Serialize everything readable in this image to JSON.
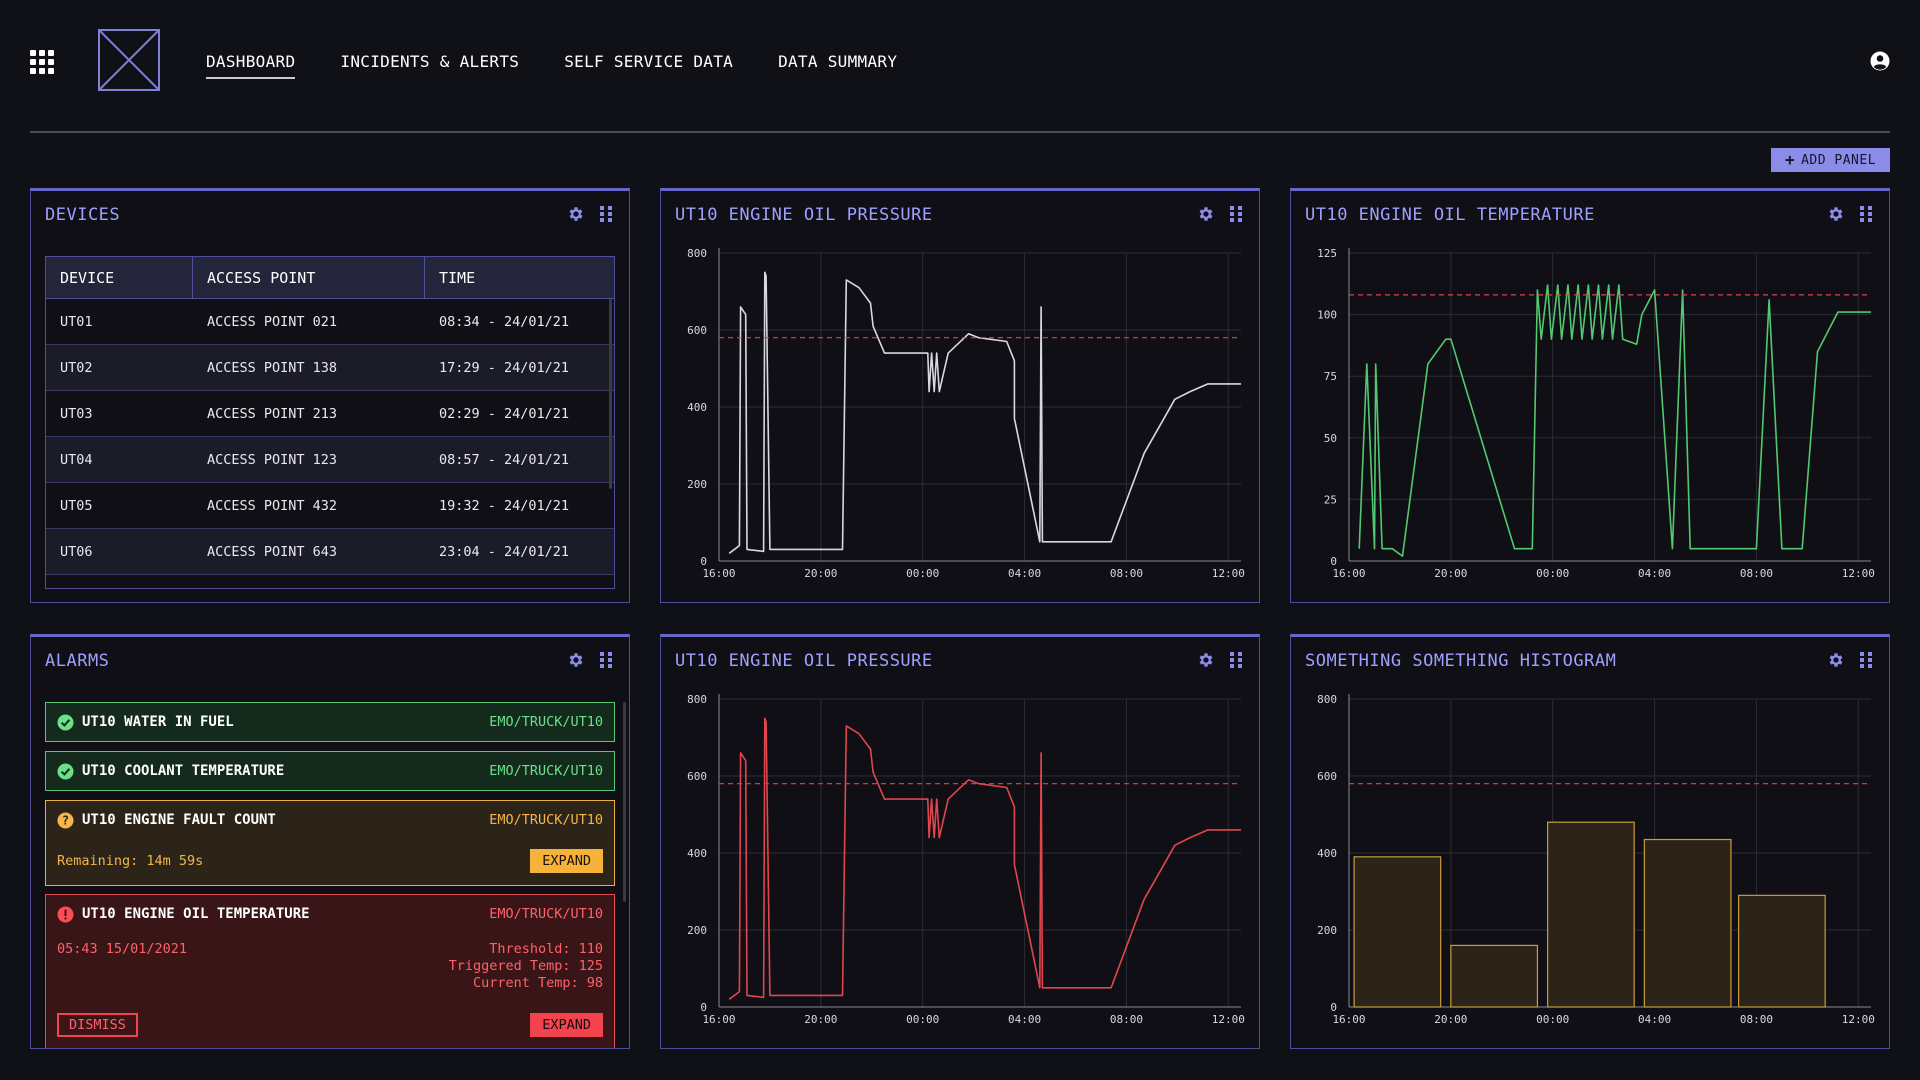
{
  "nav": {
    "items": [
      "DASHBOARD",
      "INCIDENTS & ALERTS",
      "SELF SERVICE DATA",
      "DATA SUMMARY"
    ],
    "active": "DASHBOARD"
  },
  "toolbar": {
    "add_panel_label": "ADD PANEL"
  },
  "colors": {
    "accent": "#8b8ce8",
    "panel_title": "#9fa0ff",
    "line_white": "#d8d8e0",
    "line_green": "#52c970",
    "line_red": "#e0464e",
    "bar_fill": "#2c2419",
    "bar_stroke": "#c99b3e",
    "threshold": "#d9454e"
  },
  "devices": {
    "title": "DEVICES",
    "columns": [
      "DEVICE",
      "ACCESS POINT",
      "TIME"
    ],
    "rows": [
      [
        "UT01",
        "ACCESS POINT 021",
        "08:34 - 24/01/21"
      ],
      [
        "UT02",
        "ACCESS POINT 138",
        "17:29 - 24/01/21"
      ],
      [
        "UT03",
        "ACCESS POINT 213",
        "02:29 - 24/01/21"
      ],
      [
        "UT04",
        "ACCESS POINT 123",
        "08:57 - 24/01/21"
      ],
      [
        "UT05",
        "ACCESS POINT 432",
        "19:32 - 24/01/21"
      ],
      [
        "UT06",
        "ACCESS POINT 643",
        "23:04 - 24/01/21"
      ]
    ]
  },
  "alarms": {
    "title": "ALARMS",
    "items": [
      {
        "status": "ok",
        "title": "UT10 WATER IN FUEL",
        "path": "EMO/TRUCK/UT10"
      },
      {
        "status": "ok",
        "title": "UT10 COOLANT TEMPERATURE",
        "path": "EMO/TRUCK/UT10"
      },
      {
        "status": "warning",
        "title": "UT10 ENGINE FAULT COUNT",
        "path": "EMO/TRUCK/UT10",
        "remaining": "Remaining: 14m 59s",
        "expand_label": "EXPAND"
      },
      {
        "status": "error",
        "title": "UT10 ENGINE OIL TEMPERATURE",
        "path": "EMO/TRUCK/UT10",
        "timestamp": "05:43 15/01/2021",
        "threshold": "Threshold: 110",
        "triggered": "Triggered Temp: 125",
        "current": "Current Temp: 98",
        "dismiss_label": "DISMISS",
        "expand_label": "EXPAND"
      }
    ]
  },
  "chart_data": [
    {
      "panel_title": "UT10 ENGINE OIL PRESSURE",
      "type": "line",
      "color": "white",
      "xticks": [
        "16:00",
        "20:00",
        "00:00",
        "04:00",
        "08:00",
        "12:00"
      ],
      "xlim": [
        0,
        20.5
      ],
      "ylim": [
        0,
        800
      ],
      "yticks": [
        0,
        200,
        400,
        600,
        800
      ],
      "threshold": 580,
      "grid": true,
      "x": [
        0.4,
        0.8,
        0.85,
        1.05,
        1.1,
        1.75,
        1.8,
        1.85,
        2.0,
        4.85,
        5.0,
        5.5,
        5.95,
        6.05,
        6.5,
        8.2,
        8.25,
        8.35,
        8.45,
        8.55,
        8.65,
        9.0,
        9.8,
        10.2,
        11.3,
        11.6,
        11.6,
        12.6,
        12.65,
        12.7,
        13.6,
        15.4,
        16.7,
        17.3,
        17.9,
        18.5,
        19.2,
        19.8,
        20.5
      ],
      "y": [
        20,
        40,
        660,
        640,
        30,
        25,
        750,
        740,
        30,
        30,
        730,
        710,
        670,
        610,
        540,
        540,
        440,
        540,
        440,
        540,
        440,
        540,
        590,
        580,
        570,
        520,
        370,
        50,
        660,
        50,
        50,
        50,
        280,
        350,
        420,
        440,
        460,
        460,
        460
      ]
    },
    {
      "panel_title": "UT10 ENGINE OIL TEMPERATURE",
      "type": "line",
      "color": "green",
      "xticks": [
        "16:00",
        "20:00",
        "00:00",
        "04:00",
        "08:00",
        "12:00"
      ],
      "xlim": [
        0,
        20.5
      ],
      "ylim": [
        0,
        125
      ],
      "yticks": [
        0,
        25,
        50,
        75,
        100,
        125
      ],
      "threshold": 108,
      "grid": true,
      "x": [
        0.4,
        0.7,
        1.0,
        1.05,
        1.3,
        1.7,
        2.1,
        3.1,
        3.8,
        4.0,
        6.5,
        7.2,
        7.4,
        7.55,
        7.8,
        7.95,
        8.2,
        8.35,
        8.6,
        8.75,
        9.0,
        9.15,
        9.4,
        9.55,
        9.8,
        9.95,
        10.2,
        10.35,
        10.6,
        10.75,
        11.3,
        11.5,
        12.0,
        12.7,
        13.1,
        13.4,
        14.1,
        15.0,
        16.0,
        16.5,
        17.0,
        17.8,
        18.4,
        19.2,
        20.5
      ],
      "y": [
        5,
        80,
        5,
        80,
        5,
        5,
        2,
        80,
        90,
        90,
        5,
        5,
        110,
        90,
        112,
        90,
        112,
        90,
        112,
        90,
        112,
        90,
        112,
        90,
        112,
        90,
        112,
        90,
        112,
        90,
        88,
        100,
        110,
        5,
        110,
        5,
        5,
        5,
        5,
        106,
        5,
        5,
        85,
        101,
        101
      ]
    },
    {
      "panel_title": "UT10 ENGINE OIL PRESSURE",
      "type": "line",
      "color": "red",
      "xticks": [
        "16:00",
        "20:00",
        "00:00",
        "04:00",
        "08:00",
        "12:00"
      ],
      "xlim": [
        0,
        20.5
      ],
      "ylim": [
        0,
        800
      ],
      "yticks": [
        0,
        200,
        400,
        600,
        800
      ],
      "threshold": 580,
      "grid": true,
      "x": [
        0.4,
        0.8,
        0.85,
        1.05,
        1.1,
        1.75,
        1.8,
        1.85,
        2.0,
        4.85,
        5.0,
        5.5,
        5.95,
        6.05,
        6.5,
        8.2,
        8.25,
        8.35,
        8.45,
        8.55,
        8.65,
        9.0,
        9.8,
        10.2,
        11.3,
        11.6,
        11.6,
        12.6,
        12.65,
        12.7,
        13.6,
        15.4,
        16.7,
        17.3,
        17.9,
        18.5,
        19.2,
        19.8,
        20.5
      ],
      "y": [
        20,
        40,
        660,
        640,
        30,
        25,
        750,
        740,
        30,
        30,
        730,
        710,
        670,
        610,
        540,
        540,
        440,
        540,
        440,
        540,
        440,
        540,
        590,
        580,
        570,
        520,
        370,
        50,
        660,
        50,
        50,
        50,
        280,
        350,
        420,
        440,
        460,
        460,
        460
      ]
    },
    {
      "panel_title": "SOMETHING SOMETHING HISTOGRAM",
      "type": "bar",
      "xticks": [
        "16:00",
        "20:00",
        "00:00",
        "04:00",
        "08:00",
        "12:00"
      ],
      "xlim": [
        0,
        20.5
      ],
      "ylim": [
        0,
        800
      ],
      "yticks": [
        0,
        200,
        400,
        600,
        800
      ],
      "threshold": 580,
      "grid": true,
      "bins": [
        [
          0.2,
          3.6
        ],
        [
          4.0,
          7.4
        ],
        [
          7.8,
          11.2
        ],
        [
          11.6,
          15.0
        ],
        [
          15.3,
          18.7
        ]
      ],
      "values": [
        390,
        160,
        480,
        435,
        290
      ]
    }
  ]
}
